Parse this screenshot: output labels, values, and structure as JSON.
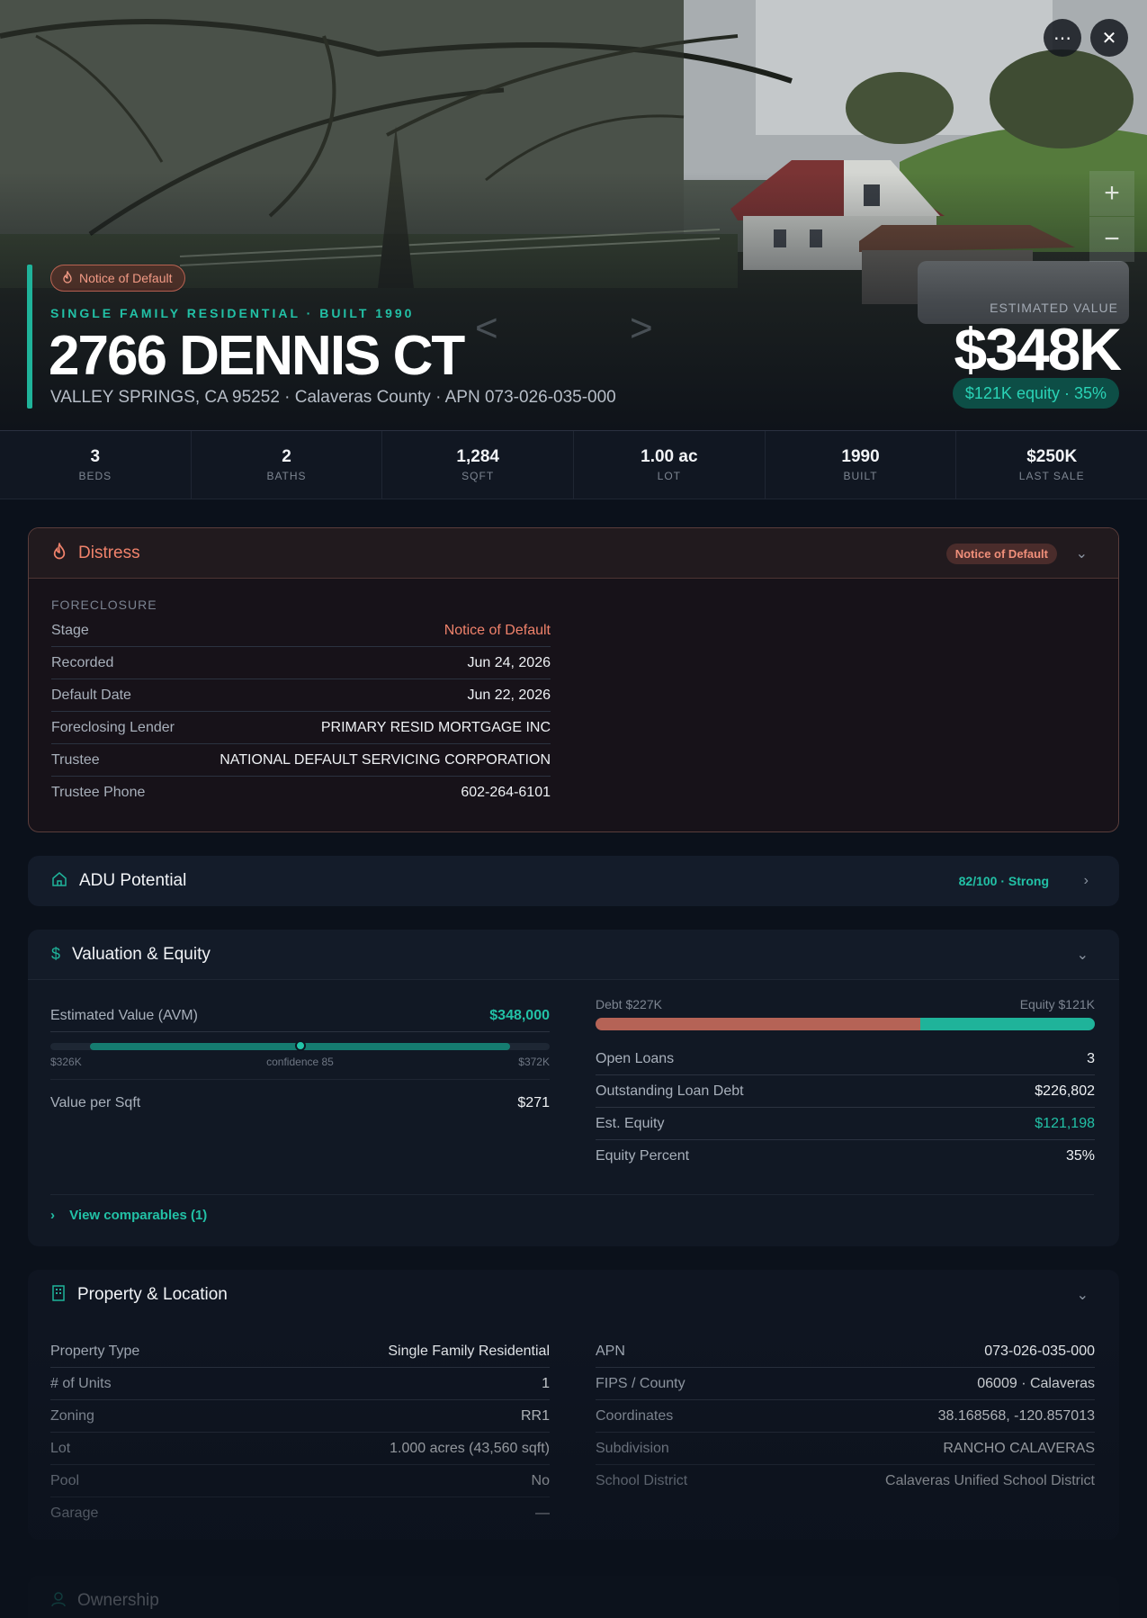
{
  "hero": {
    "status_pill": "Notice of Default",
    "subtitle": "SINGLE FAMILY RESIDENTIAL · BUILT 1990",
    "title": "2766 DENNIS CT",
    "address": "VALLEY SPRINGS, CA 95252 · Calaveras County · APN 073-026-035-000",
    "estimated_label": "ESTIMATED VALUE",
    "estimated_value": "$348K",
    "equity_pill": "$121K equity · 35%",
    "nav_prev": "<",
    "nav_next": ">"
  },
  "stats": [
    {
      "value": "3",
      "label": "BEDS"
    },
    {
      "value": "2",
      "label": "BATHS"
    },
    {
      "value": "1,284",
      "label": "SQFT"
    },
    {
      "value": "1.00 ac",
      "label": "LOT"
    },
    {
      "value": "1990",
      "label": "BUILT"
    },
    {
      "value": "$250K",
      "label": "LAST SALE"
    }
  ],
  "distress": {
    "title": "Distress",
    "badge": "Notice of Default",
    "section_label": "FORECLOSURE",
    "rows": [
      {
        "key": "Stage",
        "value": "Notice of Default"
      },
      {
        "key": "Recorded",
        "value": "Jun 24, 2026"
      },
      {
        "key": "Default Date",
        "value": "Jun 22, 2026"
      },
      {
        "key": "Foreclosing Lender",
        "value": "PRIMARY RESID MORTGAGE INC"
      },
      {
        "key": "Trustee",
        "value": "NATIONAL DEFAULT SERVICING CORPORATION"
      },
      {
        "key": "Trustee Phone",
        "value": "602-264-6101"
      }
    ]
  },
  "adu": {
    "title": "ADU Potential",
    "score": "82/100 · Strong"
  },
  "valuation": {
    "title": "Valuation & Equity",
    "avm_label": "Estimated Value (AVM)",
    "avm_value": "$348,000",
    "range_low": "$326K",
    "confidence": "confidence 85",
    "range_high": "$372K",
    "value_per_sqft_label": "Value per Sqft",
    "value_per_sqft": "$271",
    "debt_label": "Debt $227K",
    "equity_label": "Equity $121K",
    "debt_fraction": 0.65,
    "rows": [
      {
        "key": "Open Loans",
        "value": "3"
      },
      {
        "key": "Outstanding Loan Debt",
        "value": "$226,802"
      },
      {
        "key": "Est. Equity",
        "value": "$121,198"
      },
      {
        "key": "Equity Percent",
        "value": "35%"
      }
    ],
    "comparables": "View comparables (1)"
  },
  "property": {
    "title": "Property & Location",
    "left_rows": [
      {
        "key": "Property Type",
        "value": "Single Family Residential"
      },
      {
        "key": "# of Units",
        "value": "1"
      },
      {
        "key": "Zoning",
        "value": "RR1"
      },
      {
        "key": "Lot",
        "value": "1.000 acres (43,560 sqft)"
      },
      {
        "key": "Pool",
        "value": "No"
      },
      {
        "key": "Garage",
        "value": "—"
      }
    ],
    "right_rows": [
      {
        "key": "APN",
        "value": "073-026-035-000"
      },
      {
        "key": "FIPS / County",
        "value": "06009 · Calaveras"
      },
      {
        "key": "Coordinates",
        "value": "38.168568, -120.857013"
      },
      {
        "key": "Subdivision",
        "value": "RANCHO CALAVERAS"
      },
      {
        "key": "School District",
        "value": "Calaveras Unified School District"
      }
    ]
  },
  "ownership": {
    "title": "Ownership"
  },
  "colors": {
    "accent": "#1fb39a",
    "distress": "#f0826b",
    "debt": "#b56356"
  },
  "icons": {
    "more": "more-icon",
    "close": "close-icon",
    "zoom_in": "plus-icon",
    "zoom_out": "minus-icon",
    "flame": "flame-icon",
    "home": "home-icon",
    "dollar": "dollar-icon",
    "building": "building-icon",
    "user": "user-icon"
  }
}
